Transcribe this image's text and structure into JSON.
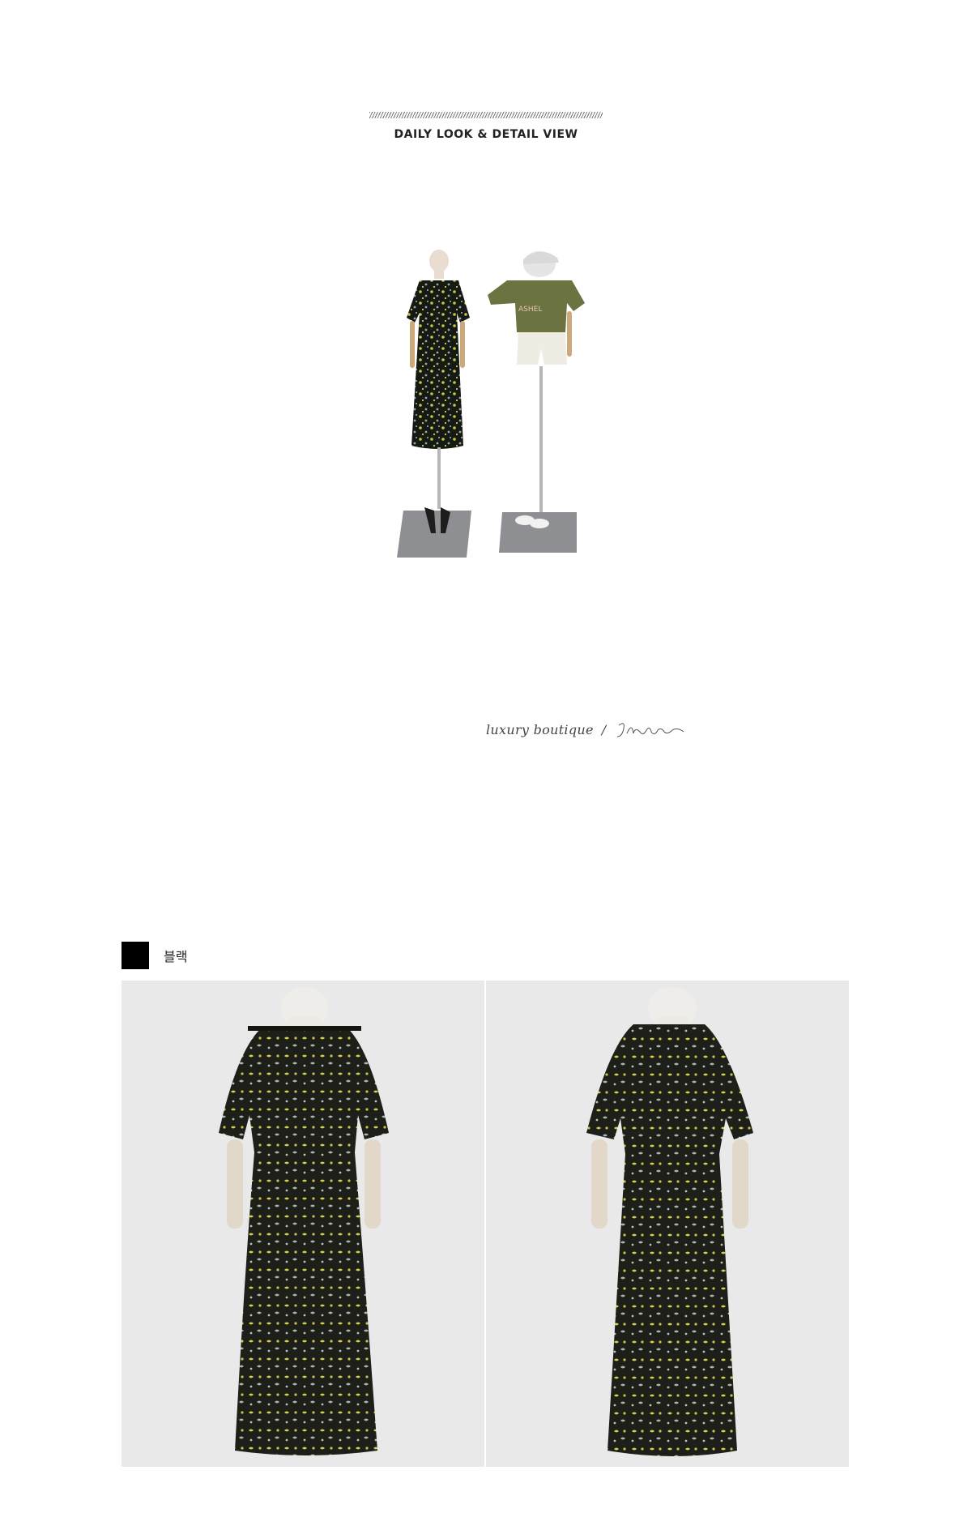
{
  "header": {
    "title": "DAILY LOOK & DETAIL VIEW"
  },
  "brand": {
    "text": "luxury boutique",
    "separator": "/",
    "signature": "Jblanc"
  },
  "color_option": {
    "name": "블랙",
    "swatch": "#000000"
  },
  "icons": [
    "diagonal-rule-icon",
    "signature-logo"
  ]
}
